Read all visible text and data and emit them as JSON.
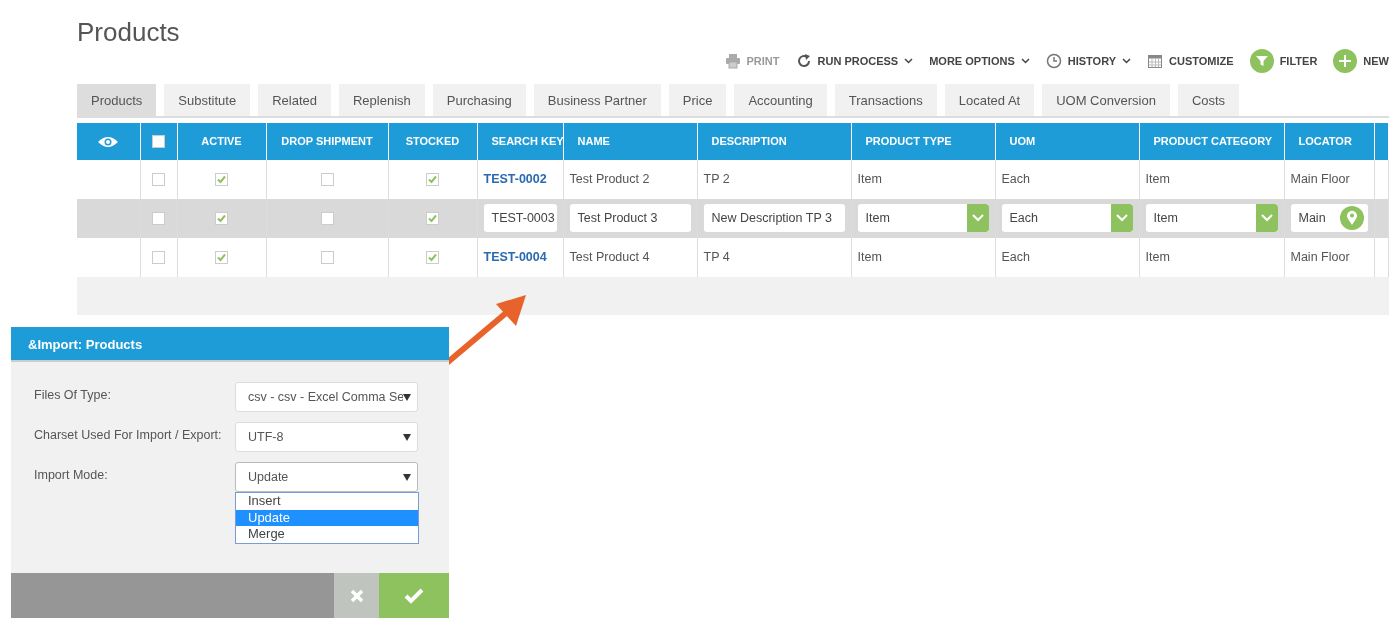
{
  "title": "Products",
  "toolbar": [
    {
      "kind": "print",
      "label": "PRINT",
      "dropdown": false,
      "disabled": true
    },
    {
      "kind": "run",
      "label": "RUN PROCESS",
      "dropdown": true,
      "disabled": false
    },
    {
      "kind": "more",
      "label": "MORE OPTIONS",
      "dropdown": true,
      "disabled": false
    },
    {
      "kind": "history",
      "label": "HISTORY",
      "dropdown": true,
      "disabled": false
    },
    {
      "kind": "customize",
      "label": "CUSTOMIZE",
      "dropdown": false,
      "disabled": false
    },
    {
      "kind": "filter",
      "label": "FILTER",
      "dropdown": false,
      "disabled": false
    },
    {
      "kind": "new",
      "label": "NEW",
      "dropdown": false,
      "disabled": false
    }
  ],
  "tabs": [
    {
      "label": "Products",
      "selected": true
    },
    {
      "label": "Substitute",
      "selected": false
    },
    {
      "label": "Related",
      "selected": false
    },
    {
      "label": "Replenish",
      "selected": false
    },
    {
      "label": "Purchasing",
      "selected": false
    },
    {
      "label": "Business Partner",
      "selected": false
    },
    {
      "label": "Price",
      "selected": false
    },
    {
      "label": "Accounting",
      "selected": false
    },
    {
      "label": "Transactions",
      "selected": false
    },
    {
      "label": "Located At",
      "selected": false
    },
    {
      "label": "UOM Conversion",
      "selected": false
    },
    {
      "label": "Costs",
      "selected": false
    }
  ],
  "table": {
    "header_checked": false,
    "columns": [
      "ACTIVE",
      "DROP SHIPMENT",
      "STOCKED",
      "SEARCH KEY",
      "NAME",
      "DESCRIPTION",
      "PRODUCT TYPE",
      "UOM",
      "PRODUCT CATEGORY",
      "LOCATOR"
    ],
    "rows": [
      {
        "editing": false,
        "checked": false,
        "active": true,
        "drop_shipment": false,
        "stocked": true,
        "search_key": "TEST-0002",
        "name": "Test Product 2",
        "description": "TP 2",
        "product_type": "Item",
        "uom": "Each",
        "product_category": "Item",
        "locator": "Main Floor"
      },
      {
        "editing": true,
        "checked": false,
        "active": true,
        "drop_shipment": false,
        "stocked": true,
        "search_key": "TEST-0003",
        "name": "Test Product 3",
        "description": "New Description TP 3",
        "product_type": "Item",
        "uom": "Each",
        "product_category": "Item",
        "locator": "Main"
      },
      {
        "editing": false,
        "checked": false,
        "active": true,
        "drop_shipment": false,
        "stocked": true,
        "search_key": "TEST-0004",
        "name": "Test Product 4",
        "description": "TP 4",
        "product_type": "Item",
        "uom": "Each",
        "product_category": "Item",
        "locator": "Main Floor"
      }
    ]
  },
  "dialog": {
    "title": "&Import: Products",
    "fields": [
      {
        "label": "Files Of Type:",
        "value": "csv - csv - Excel Comma Se",
        "expanded": false
      },
      {
        "label": "Charset Used For Import / Export:",
        "value": "UTF-8",
        "expanded": false
      },
      {
        "label": "Import Mode:",
        "value": "Update",
        "expanded": true,
        "options": [
          {
            "label": "Insert",
            "selected": false
          },
          {
            "label": "Update",
            "selected": true
          },
          {
            "label": "Merge",
            "selected": false
          }
        ]
      }
    ]
  }
}
